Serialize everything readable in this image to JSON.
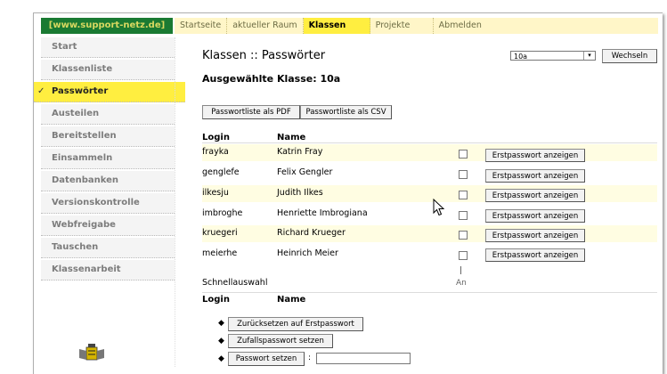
{
  "site_label": "[www.support-netz.de]",
  "topnav": [
    "Startseite",
    "aktueller Raum",
    "Klassen",
    "Projekte",
    "Abmelden"
  ],
  "topnav_active": 2,
  "sidebar": [
    "Start",
    "Klassenliste",
    "Passwörter",
    "Austeilen",
    "Bereitstellen",
    "Einsammeln",
    "Datenbanken",
    "Versionskontrolle",
    "Webfreigabe",
    "Tauschen",
    "Klassenarbeit"
  ],
  "sidebar_active": 2,
  "page_title": "Klassen :: Passwörter",
  "selected_class": "Ausgewählte Klasse: 10a",
  "class_select_value": "10a",
  "change_button": "Wechseln",
  "pdf_button": "Passwortliste als PDF",
  "csv_button": "Passwortliste als CSV",
  "headers": {
    "login": "Login",
    "name": "Name"
  },
  "rows": [
    {
      "login": "frayka",
      "name": "Katrin Fray"
    },
    {
      "login": "genglefe",
      "name": "Felix Gengler"
    },
    {
      "login": "ilkesju",
      "name": "Judith Ilkes"
    },
    {
      "login": "imbroghe",
      "name": "Henriette Imbrogiana"
    },
    {
      "login": "kruegeri",
      "name": "Richard Krueger"
    },
    {
      "login": "meierhe",
      "name": "Heinrich Meier"
    }
  ],
  "show_initial_password": "Erstpasswort anzeigen",
  "quick_select": "Schnellauswahl",
  "all_label": "An",
  "actions": {
    "reset": "Zurücksetzen auf Erstpasswort",
    "random": "Zufallspasswort setzen",
    "set": "Passwort setzen",
    "colon": ":"
  },
  "colors": {
    "site_bg": "#1a7a32",
    "active_yellow": "#ffee40",
    "nav_bg": "#fff6c8",
    "row_alt": "#fffde2"
  }
}
